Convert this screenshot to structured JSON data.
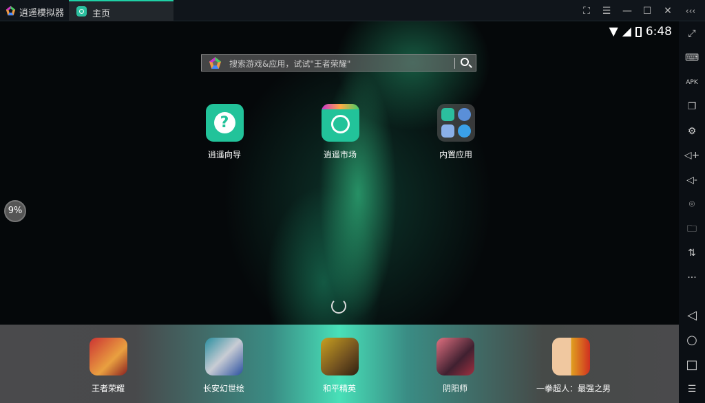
{
  "titlebar": {
    "app_title": "逍遥模拟器",
    "tab_label": "主页",
    "buttons": [
      "screenshot-region",
      "menu",
      "minimize",
      "maximize",
      "close",
      "collapse"
    ]
  },
  "status": {
    "time": "6:48"
  },
  "search": {
    "placeholder": "搜索游戏&应用，试试\"王者荣耀\""
  },
  "home_apps": [
    {
      "label": "逍遥向导",
      "icon": "help-icon"
    },
    {
      "label": "逍遥市场",
      "icon": "market-icon"
    },
    {
      "label": "内置应用",
      "icon": "folder-icon"
    }
  ],
  "progress": {
    "label": "9%",
    "value": 9
  },
  "dock": [
    {
      "label": "王者荣耀"
    },
    {
      "label": "长安幻世绘"
    },
    {
      "label": "和平精英"
    },
    {
      "label": "阴阳师"
    },
    {
      "label": "一拳超人：最强之男"
    }
  ],
  "sidebar": [
    "fullscreen",
    "keyboard",
    "apk",
    "multi-window",
    "settings",
    "volume-up",
    "volume-down",
    "location",
    "folder",
    "rotate",
    "more",
    "back",
    "home",
    "recents",
    "menu"
  ],
  "colors": {
    "accent": "#1fd1a6",
    "titlebar": "#10151b",
    "sidebar": "#0b0f14"
  }
}
